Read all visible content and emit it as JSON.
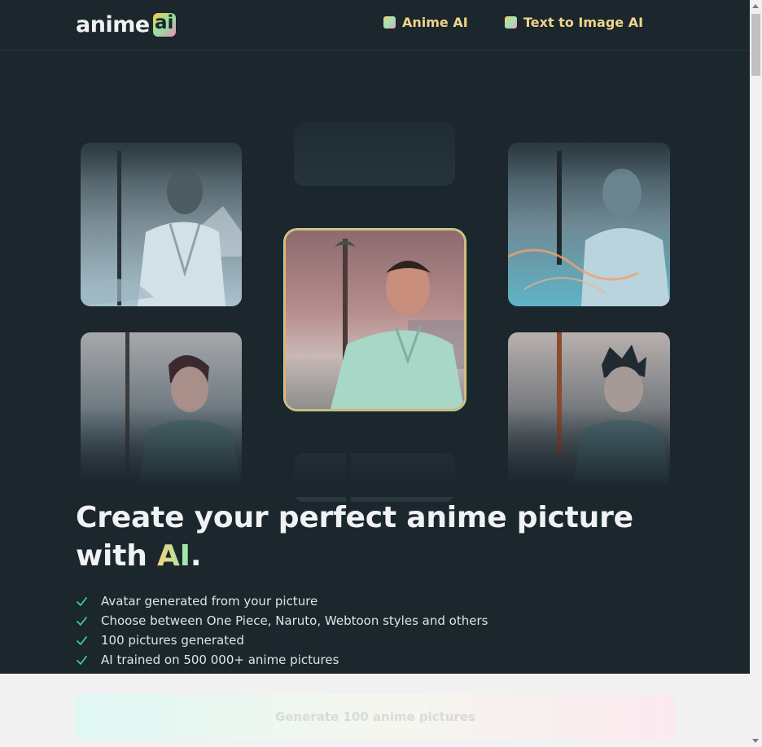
{
  "header": {
    "logo_text": "anime",
    "logo_badge": "ai",
    "nav": [
      {
        "label": "Anime AI"
      },
      {
        "label": "Text to Image AI"
      }
    ]
  },
  "hero": {
    "headline_main": "Create your perfect anime picture with ",
    "headline_accent": "AI",
    "headline_end": ".",
    "features": [
      "Avatar generated from your picture",
      "Choose between One Piece, Naruto, Webtoon styles and others",
      "100 pictures generated",
      "AI trained on 500 000+ anime pictures"
    ]
  },
  "cta": {
    "label": "Generate 100 anime pictures"
  },
  "colors": {
    "background": "#1b262d",
    "accent_yellow": "#f0d489",
    "accent_green": "#94e8b6",
    "accent_pink": "#f39bb8",
    "check": "#3fce8a"
  }
}
